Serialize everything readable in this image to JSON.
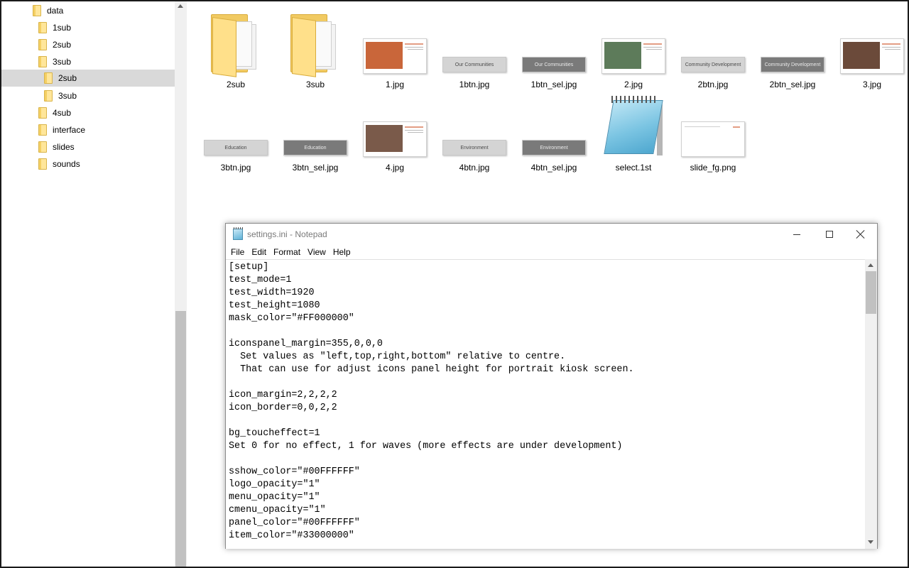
{
  "nav": {
    "items": [
      {
        "label": "data",
        "level": 0,
        "selected": false
      },
      {
        "label": "1sub",
        "level": 1,
        "selected": false
      },
      {
        "label": "2sub",
        "level": 1,
        "selected": false
      },
      {
        "label": "3sub",
        "level": 1,
        "selected": false
      },
      {
        "label": "2sub",
        "level": 2,
        "selected": true
      },
      {
        "label": "3sub",
        "level": 2,
        "selected": false
      },
      {
        "label": "4sub",
        "level": 1,
        "selected": false
      },
      {
        "label": "interface",
        "level": 1,
        "selected": false
      },
      {
        "label": "slides",
        "level": 1,
        "selected": false
      },
      {
        "label": "sounds",
        "level": 1,
        "selected": false
      }
    ]
  },
  "files": [
    {
      "name": "2sub",
      "kind": "folder-icon"
    },
    {
      "name": "3sub",
      "kind": "folder-icon"
    },
    {
      "name": "1.jpg",
      "kind": "photo",
      "color": "#c9663a"
    },
    {
      "name": "1btn.jpg",
      "kind": "button",
      "caption": "Our Communities",
      "variant": "norm"
    },
    {
      "name": "1btn_sel.jpg",
      "kind": "button",
      "caption": "Our Communities",
      "variant": "sel"
    },
    {
      "name": "2.jpg",
      "kind": "photo",
      "color": "#5d7b5a"
    },
    {
      "name": "2btn.jpg",
      "kind": "button",
      "caption": "Community Development",
      "variant": "norm"
    },
    {
      "name": "2btn_sel.jpg",
      "kind": "button",
      "caption": "Community Development",
      "variant": "sel"
    },
    {
      "name": "3.jpg",
      "kind": "photo",
      "color": "#6b4a3a"
    },
    {
      "name": "3btn.jpg",
      "kind": "button",
      "caption": "Education",
      "variant": "norm"
    },
    {
      "name": "3btn_sel.jpg",
      "kind": "button",
      "caption": "Education",
      "variant": "sel"
    },
    {
      "name": "4.jpg",
      "kind": "photo",
      "color": "#7a5a4a"
    },
    {
      "name": "4btn.jpg",
      "kind": "button",
      "caption": "Environment",
      "variant": "norm"
    },
    {
      "name": "4btn_sel.jpg",
      "kind": "button",
      "caption": "Environment",
      "variant": "sel"
    },
    {
      "name": "select.1st",
      "kind": "notepad-icon"
    },
    {
      "name": "slide_fg.png",
      "kind": "blank"
    }
  ],
  "notepad": {
    "title": "settings.ini - Notepad",
    "menu": [
      "File",
      "Edit",
      "Format",
      "View",
      "Help"
    ],
    "lines": [
      "[setup]",
      "test_mode=1",
      "test_width=1920",
      "test_height=1080",
      "mask_color=\"#FF000000\"",
      "",
      "iconspanel_margin=355,0,0,0",
      "  Set values as \"left,top,right,bottom\" relative to centre.",
      "  That can use for adjust icons panel height for portrait kiosk screen.",
      "",
      "icon_margin=2,2,2,2",
      "icon_border=0,0,2,2",
      "",
      "bg_toucheffect=1",
      "Set 0 for no effect, 1 for waves (more effects are under development)",
      "",
      "sshow_color=\"#00FFFFFF\"",
      "logo_opacity=\"1\"",
      "menu_opacity=\"1\"",
      "cmenu_opacity=\"1\"",
      "panel_color=\"#00FFFFFF\"",
      "item_color=\"#33000000\""
    ]
  },
  "colors": {
    "selection": "#d9d9d9",
    "folder": "#ffe69a"
  }
}
